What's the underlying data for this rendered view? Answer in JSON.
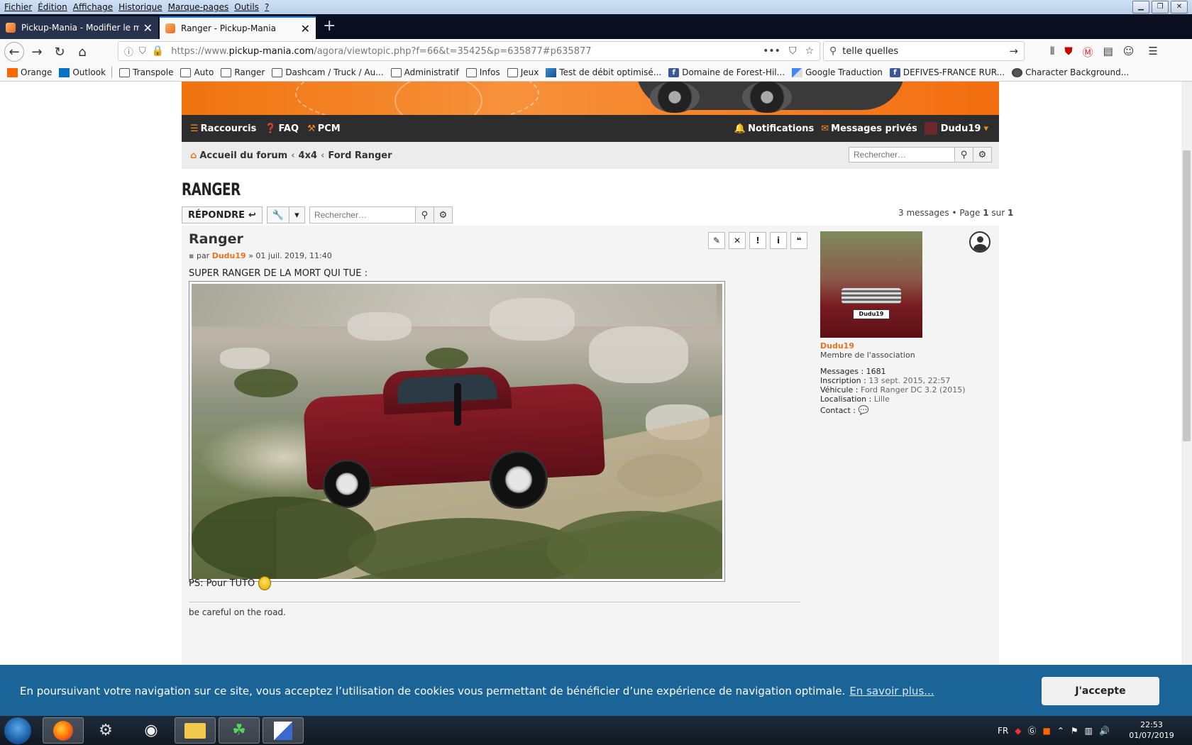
{
  "browser": {
    "menu": [
      "Fichier",
      "Édition",
      "Affichage",
      "Historique",
      "Marque-pages",
      "Outils",
      "?"
    ],
    "tabs": [
      {
        "title": "Pickup-Mania - Modifier le me"
      },
      {
        "title": "Ranger - Pickup-Mania"
      }
    ],
    "url_prefix": "https://www.",
    "url_domain": "pickup-mania.com",
    "url_path": "/agora/viewtopic.php?f=66&t=35425&p=635877#p635877",
    "search_value": "telle quelles",
    "bookmarks": [
      {
        "label": "Orange",
        "icon": "orange-icon"
      },
      {
        "label": "Outlook",
        "icon": "outlook-icon"
      },
      {
        "label": "Transpole",
        "icon": "folder-icon"
      },
      {
        "label": "Auto",
        "icon": "folder-icon"
      },
      {
        "label": "Ranger",
        "icon": "folder-icon"
      },
      {
        "label": "Dashcam / Truck / Au...",
        "icon": "folder-icon"
      },
      {
        "label": "Administratif",
        "icon": "folder-icon"
      },
      {
        "label": "Infos",
        "icon": "folder-icon"
      },
      {
        "label": "Jeux",
        "icon": "folder-icon"
      },
      {
        "label": "Test de débit optimisé...",
        "icon": "speedtest-icon"
      },
      {
        "label": "Domaine de Forest-Hil...",
        "icon": "facebook-icon"
      },
      {
        "label": "Google Traduction",
        "icon": "google-translate-icon"
      },
      {
        "label": "DEFIVES-FRANCE RUR...",
        "icon": "facebook-icon"
      },
      {
        "label": "Character Background...",
        "icon": "character-icon"
      }
    ]
  },
  "forum": {
    "nav": {
      "shortcuts": "Raccourcis",
      "faq": "FAQ",
      "pcm": "PCM",
      "notifications": "Notifications",
      "messages": "Messages privés",
      "username": "Dudu19"
    },
    "breadcrumb": [
      "Accueil du forum",
      "4x4",
      "Ford Ranger"
    ],
    "search_placeholder": "Rechercher…",
    "topic_title": "RANGER",
    "reply_label": "RÉPONDRE",
    "topic_search_placeholder": "Rechercher…",
    "pagination": {
      "prefix": "3 messages • Page ",
      "page": "1",
      "mid": " sur ",
      "total": "1"
    },
    "post": {
      "title": "Ranger",
      "by": "par",
      "author": "Dudu19",
      "date": "» 01 juil. 2019, 11:40",
      "text": "SUPER RANGER DE LA MORT QUI TUE :",
      "ps": "PS: Pour TUTO",
      "signature": "be careful on the road."
    },
    "profile": {
      "avatar_plate": "Dudu19",
      "username": "Dudu19",
      "rank": "Membre de l'association",
      "stats": [
        {
          "label": "Messages :",
          "value": "1681"
        },
        {
          "label": "Inscription :",
          "value": "13 sept. 2015, 22:57"
        },
        {
          "label": "Véhicule :",
          "value": "Ford Ranger DC 3.2 (2015)"
        },
        {
          "label": "Localisation :",
          "value": "Lille"
        }
      ],
      "contact_label": "Contact :"
    }
  },
  "cookie": {
    "message": "En poursuivant votre navigation sur ce site, vous acceptez l’utilisation de cookies vous permettant de bénéficier d’une expérience de navigation optimale.",
    "more": "En savoir plus...",
    "accept": "J'accepte"
  },
  "taskbar": {
    "lang": "FR",
    "time": "22:53",
    "date": "01/07/2019"
  },
  "colors": {
    "accent": "#e8731e",
    "cookie_bg": "#1b6497",
    "nav_dark": "#2d2d2d"
  }
}
